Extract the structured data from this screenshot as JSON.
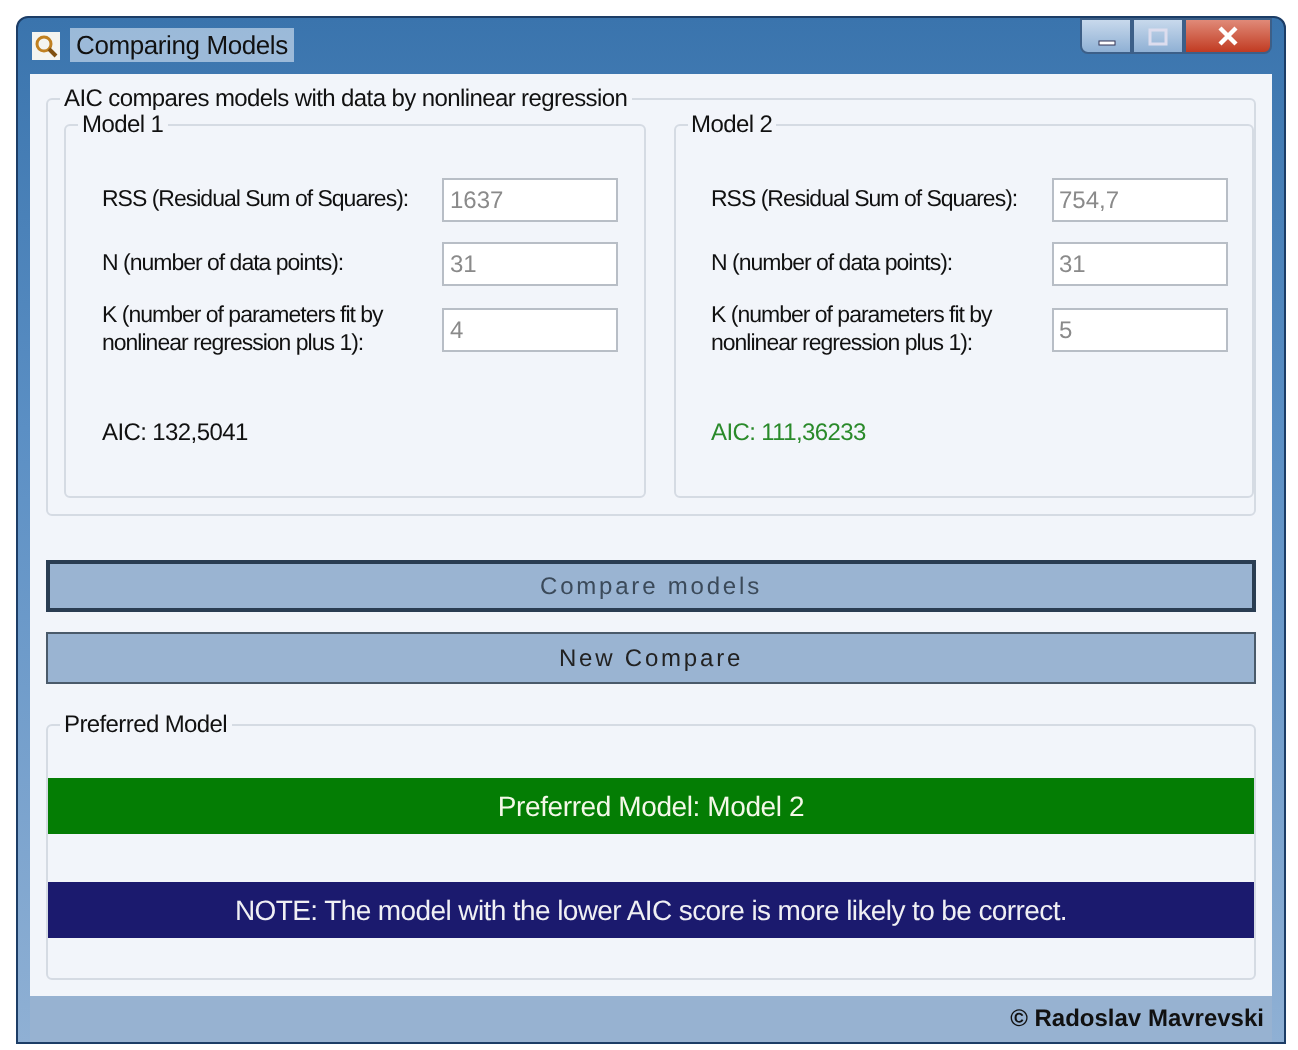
{
  "window": {
    "title": "Comparing Models"
  },
  "group": {
    "title": "AIC compares models with data by nonlinear regression"
  },
  "models": [
    {
      "title": "Model 1",
      "fields": [
        {
          "label": "RSS (Residual Sum of Squares):",
          "value": "1637"
        },
        {
          "label": "N (number of data points):",
          "value": "31"
        },
        {
          "label": "K (number of parameters fit by nonlinear regression plus 1):",
          "value": "4"
        }
      ],
      "aic": "AIC: 132,5041",
      "preferred": false
    },
    {
      "title": "Model 2",
      "fields": [
        {
          "label": "RSS (Residual Sum of Squares):",
          "value": "754,7"
        },
        {
          "label": "N (number of data points):",
          "value": "31"
        },
        {
          "label": "K (number of parameters fit by nonlinear regression plus 1):",
          "value": "5"
        }
      ],
      "aic": "AIC: 111,36233",
      "preferred": true
    }
  ],
  "buttons": [
    {
      "label": "Compare models",
      "focused": true
    },
    {
      "label": "New Compare",
      "focused": false
    }
  ],
  "preferred_group": {
    "title": "Preferred Model",
    "result": "Preferred Model: Model 2",
    "note": "NOTE: The model with the lower AIC score is more likely to be correct."
  },
  "status_bar": {
    "text": "© Radoslav Mavrevski"
  }
}
